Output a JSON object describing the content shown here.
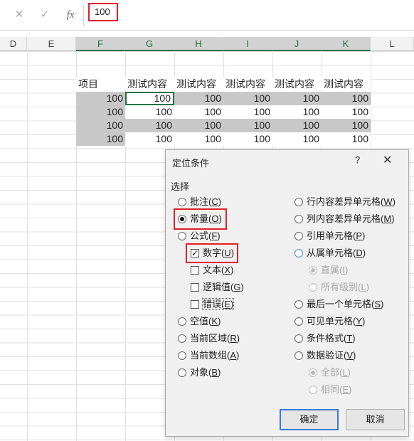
{
  "formula_bar": {
    "cancel_glyph": "✕",
    "confirm_glyph": "✓",
    "fx_label": "fx",
    "value": "100"
  },
  "columns": [
    "D",
    "E",
    "F",
    "G",
    "H",
    "I",
    "J",
    "K",
    "L"
  ],
  "sheet": {
    "header_label": "项目",
    "header_cells": [
      "测试内容",
      "测试内容",
      "测试内容",
      "测试内容",
      "测试内容"
    ],
    "rows": [
      [
        "100",
        "100",
        "100",
        "100",
        "100",
        "100"
      ],
      [
        "100",
        "100",
        "100",
        "100",
        "100",
        "100"
      ],
      [
        "100",
        "100",
        "100",
        "100",
        "100",
        "100"
      ],
      [
        "100",
        "100",
        "100",
        "100",
        "100",
        "100"
      ]
    ]
  },
  "dialog": {
    "title": "定位条件",
    "help": "?",
    "close": "✕",
    "section": "选择",
    "left_options": [
      {
        "label": "批注(",
        "key": "C",
        "tail": ")"
      },
      {
        "label": "常量(",
        "key": "O",
        "tail": ")"
      },
      {
        "label": "公式(",
        "key": "F",
        "tail": ")"
      },
      {
        "label": "数字(",
        "key": "U",
        "tail": ")"
      },
      {
        "label": "文本(",
        "key": "X",
        "tail": ")"
      },
      {
        "label": "逻辑值(",
        "key": "G",
        "tail": ")"
      },
      {
        "label": "错误(",
        "key": "E",
        "tail": ")"
      },
      {
        "label": "空值(",
        "key": "K",
        "tail": ")"
      },
      {
        "label": "当前区域(",
        "key": "R",
        "tail": ")"
      },
      {
        "label": "当前数组(",
        "key": "A",
        "tail": ")"
      },
      {
        "label": "对象(",
        "key": "B",
        "tail": ")"
      }
    ],
    "right_options": [
      {
        "label": "行内容差异单元格(",
        "key": "W",
        "tail": ")"
      },
      {
        "label": "列内容差异单元格(",
        "key": "M",
        "tail": ")"
      },
      {
        "label": "引用单元格(",
        "key": "P",
        "tail": ")"
      },
      {
        "label": "从属单元格(",
        "key": "D",
        "tail": ")"
      },
      {
        "label": "直属(",
        "key": "I",
        "tail": ")"
      },
      {
        "label": "所有级别(",
        "key": "L",
        "tail": ")"
      },
      {
        "label": "最后一个单元格(",
        "key": "S",
        "tail": ")"
      },
      {
        "label": "可见单元格(",
        "key": "Y",
        "tail": ")"
      },
      {
        "label": "条件格式(",
        "key": "T",
        "tail": ")"
      },
      {
        "label": "数据验证(",
        "key": "V",
        "tail": ")"
      },
      {
        "label": "全部(",
        "key": "L",
        "tail": ")"
      },
      {
        "label": "相同(",
        "key": "E",
        "tail": ")"
      }
    ],
    "ok": "确定",
    "cancel": "取消"
  },
  "colors": {
    "highlight": "#e0202a",
    "selection_fill": "#c8c8c8",
    "accent_green": "#217346"
  }
}
